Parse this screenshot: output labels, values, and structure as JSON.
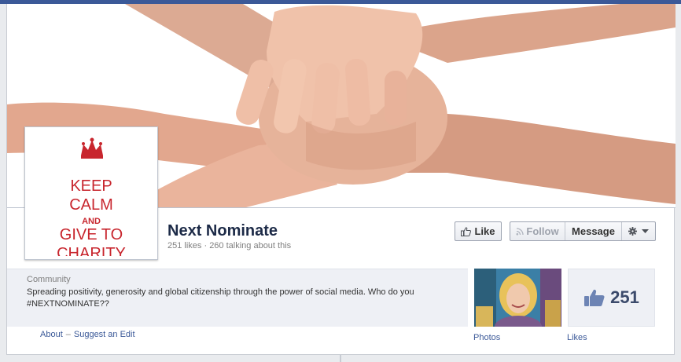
{
  "page": {
    "name": "Next Nominate",
    "stats": "251 likes · 260 talking about this"
  },
  "profile_picture": {
    "lines": [
      "KEEP",
      "CALM",
      "AND",
      "GIVE TO",
      "CHARITY"
    ]
  },
  "actions": {
    "like_label": "Like",
    "follow_label": "Follow",
    "message_label": "Message"
  },
  "about": {
    "category": "Community",
    "description": "Spreading positivity, generosity and global citizenship through the power of social media. Who do you #NEXTNOMINATE??",
    "links": [
      "About",
      "–",
      "Suggest an Edit"
    ]
  },
  "photos": {
    "label": "Photos"
  },
  "likes": {
    "count": "251",
    "label": "Likes"
  },
  "icons": {
    "like": "thumbs-up-icon",
    "follow": "rss-icon",
    "gear": "gear-icon",
    "dropdown": "caret-down-icon",
    "crown": "crown-icon"
  },
  "colors": {
    "brand_blue": "#3b5998",
    "keep_calm_red": "#c8262e",
    "page_name": "#1c2a47"
  }
}
